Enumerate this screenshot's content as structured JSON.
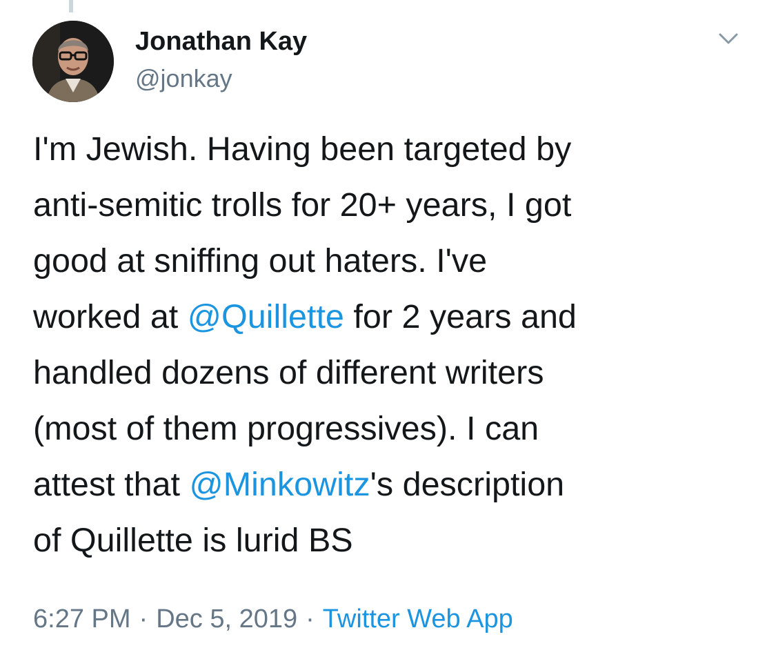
{
  "tweet": {
    "author": {
      "display_name": "Jonathan Kay",
      "handle": "@jonkay",
      "avatar_icon": "user-avatar-photo"
    },
    "menu_icon": "chevron-down-icon",
    "text_lines": [
      {
        "parts": [
          "I'm Jewish. Having been targeted by"
        ]
      },
      {
        "parts": [
          "anti-semitic trolls for 20+ years, I got"
        ]
      },
      {
        "parts": [
          "good at sniffing out haters. I've"
        ]
      },
      {
        "parts": [
          "worked at ",
          "@Quillette",
          " for 2 years and"
        ]
      },
      {
        "parts": [
          "handled dozens of different writers"
        ]
      },
      {
        "parts": [
          "(most of them progressives). I can"
        ]
      },
      {
        "parts": [
          "attest that ",
          "@Minkowitz",
          "'s description"
        ]
      },
      {
        "parts": [
          "of Quillette is lurid BS"
        ]
      }
    ],
    "mentions": [
      "@Quillette",
      "@Minkowitz"
    ],
    "time": "6:27 PM",
    "separator": "·",
    "date": "Dec 5, 2019",
    "source": "Twitter Web App"
  },
  "colors": {
    "text": "#14171a",
    "secondary": "#657786",
    "link": "#1b95e0",
    "thread_line": "#ccd6dd",
    "background": "#ffffff"
  }
}
